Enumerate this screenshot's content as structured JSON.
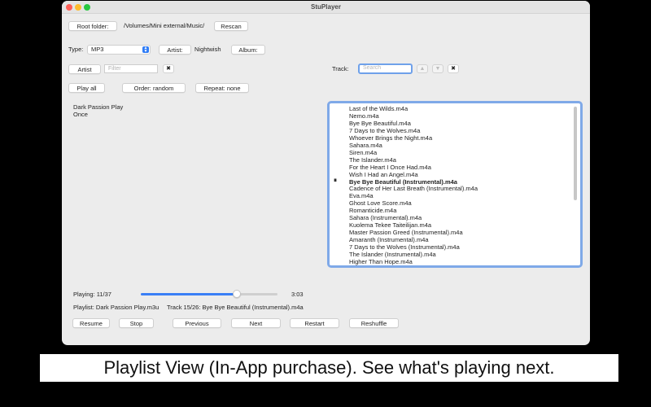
{
  "window": {
    "title": "StuPlayer"
  },
  "header": {
    "root_folder_label": "Root folder:",
    "root_path": "/Volumes/Mini external/Music/",
    "rescan_label": "Rescan"
  },
  "filters": {
    "type_label": "Type:",
    "type_value": "MP3",
    "artist_label": "Artist:",
    "artist_value": "Nightwish",
    "album_label": "Album:"
  },
  "search": {
    "artist_button": "Artist",
    "filter_placeholder": "Filter",
    "clear_symbol": "✖",
    "track_label": "Track:",
    "track_placeholder": "Search",
    "up_symbol": "▲",
    "down_symbol": "▼"
  },
  "controls": {
    "play_all": "Play all",
    "order": "Order: random",
    "repeat": "Repeat: none"
  },
  "albums": [
    "Dark Passion Play",
    "Once"
  ],
  "playlist": {
    "pause_symbol": "⏸",
    "current_index": 10,
    "tracks": [
      "Last of the Wilds.m4a",
      "Nemo.m4a",
      "Bye Bye Beautiful.m4a",
      "7 Days to the Wolves.m4a",
      "Whoever Brings the Night.m4a",
      "Sahara.m4a",
      "Siren.m4a",
      "The Islander.m4a",
      "For the Heart I Once Had.m4a",
      "Wish I Had an Angel.m4a",
      "Bye Bye Beautiful (Instrumental).m4a",
      "Cadence of Her Last Breath (Instrumental).m4a",
      "Eva.m4a",
      "Ghost Love Score.m4a",
      "Romanticide.m4a",
      "Sahara (Instrumental).m4a",
      "Kuolema Tekee Taiteilijan.m4a",
      "Master Passion Greed (Instrumental).m4a",
      "Amaranth (Instrumental).m4a",
      "7 Days to the Wolves (Instrumental).m4a",
      "The Islander (Instrumental).m4a",
      "Higher Than Hope.m4a"
    ]
  },
  "status": {
    "playing": "Playing: 11/37",
    "time": "3:03",
    "progress_fraction": 0.7,
    "playlist_info": "Playlist: Dark Passion Play.m3u",
    "track_info": "Track 15/26: Bye Bye Beautiful (Instrumental).m4a"
  },
  "transport": {
    "resume": "Resume",
    "stop": "Stop",
    "previous": "Previous",
    "next": "Next",
    "restart": "Restart",
    "reshuffle": "Reshuffle"
  },
  "caption": "Playlist View (In-App purchase). See what's playing next.",
  "colors": {
    "accent": "#3a7ff6",
    "focus_ring": "#7fa9e8"
  }
}
